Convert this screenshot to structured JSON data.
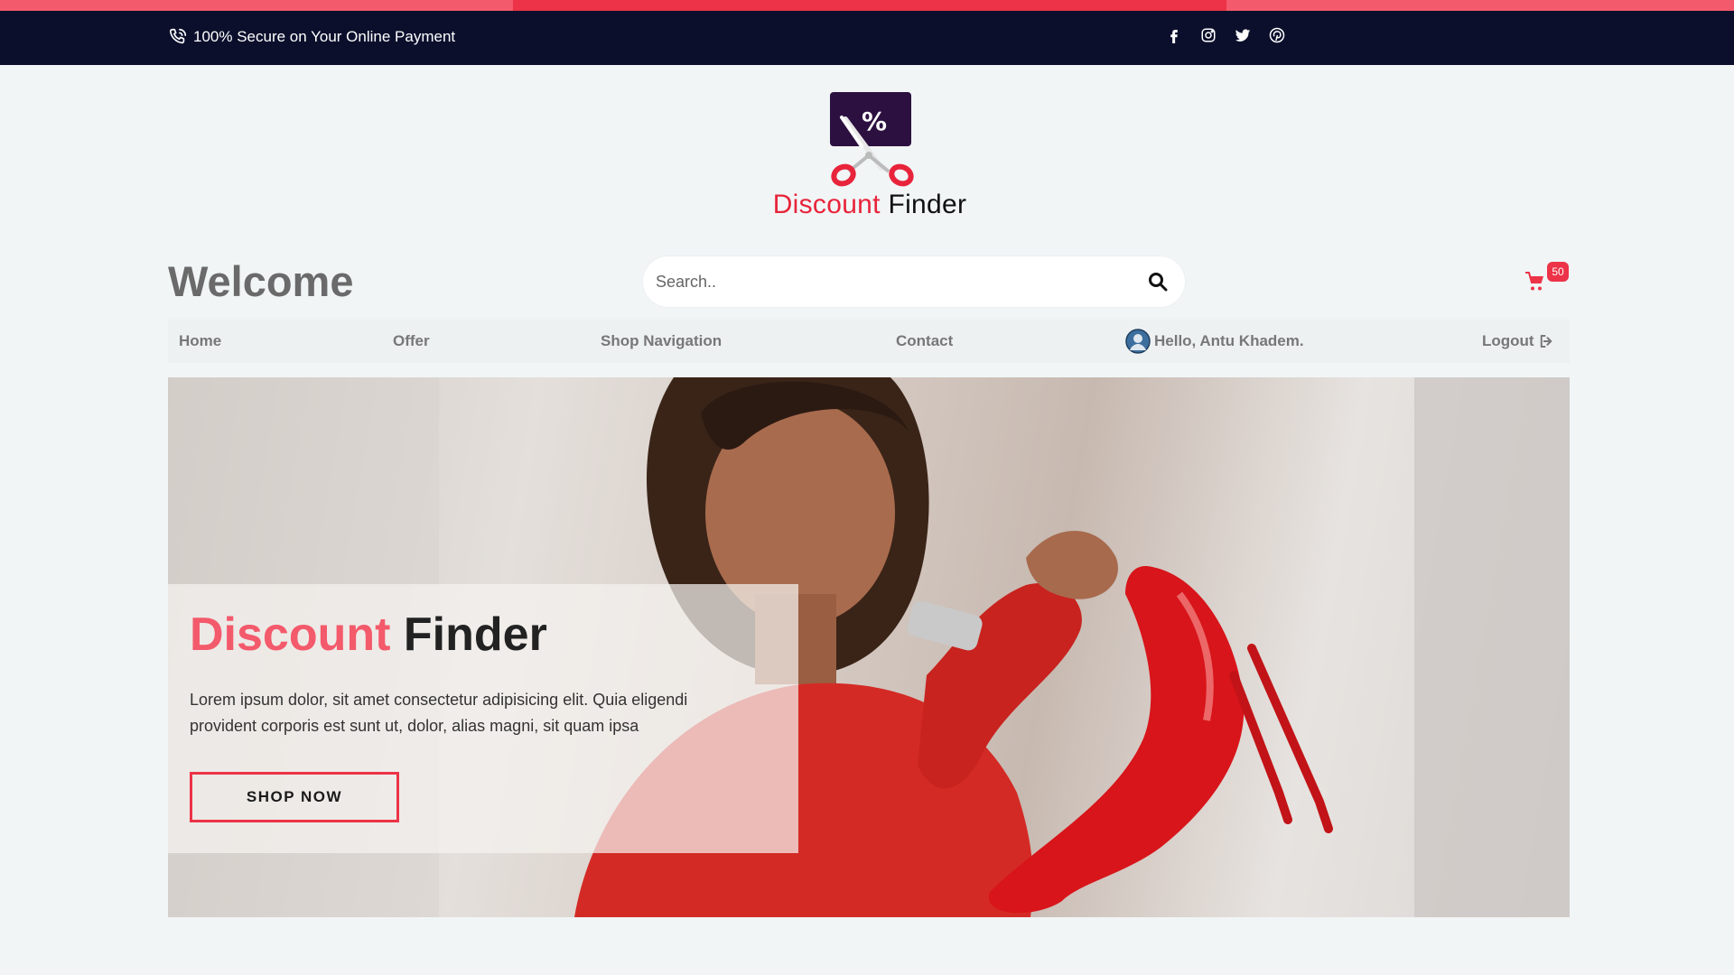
{
  "topbar": {
    "secure_text": "100% Secure on Your Online Payment",
    "phone_icon": "phone-icon",
    "socials": [
      "facebook-icon",
      "instagram-icon",
      "twitter-icon",
      "pinterest-icon"
    ]
  },
  "logo": {
    "mark_symbol": "%",
    "word1": "Discount",
    "word2": "Finder"
  },
  "header": {
    "welcome": "Welcome"
  },
  "search": {
    "placeholder": "Search..",
    "value": ""
  },
  "cart": {
    "icon": "cart-icon",
    "count": "50"
  },
  "nav": {
    "items": [
      {
        "label": "Home"
      },
      {
        "label": "Offer"
      },
      {
        "label": "Shop Navigation"
      },
      {
        "label": "Contact"
      }
    ],
    "greeting": "Hello, Antu Khadem.",
    "logout": "Logout"
  },
  "hero": {
    "title_part1": "Discount",
    "title_part2": "Finder",
    "description": "Lorem ipsum dolor, sit amet consectetur adipisicing elit. Quia eligendi provident corporis est sunt ut, dolor, alias magni, sit quam ipsa",
    "button": "SHOP NOW"
  },
  "colors": {
    "accent": "#ec3347",
    "accent_light": "#f35a6b",
    "topbar_bg": "#0b0f2c",
    "page_bg": "#f1f5f6",
    "logo_purple": "#2c1040"
  }
}
